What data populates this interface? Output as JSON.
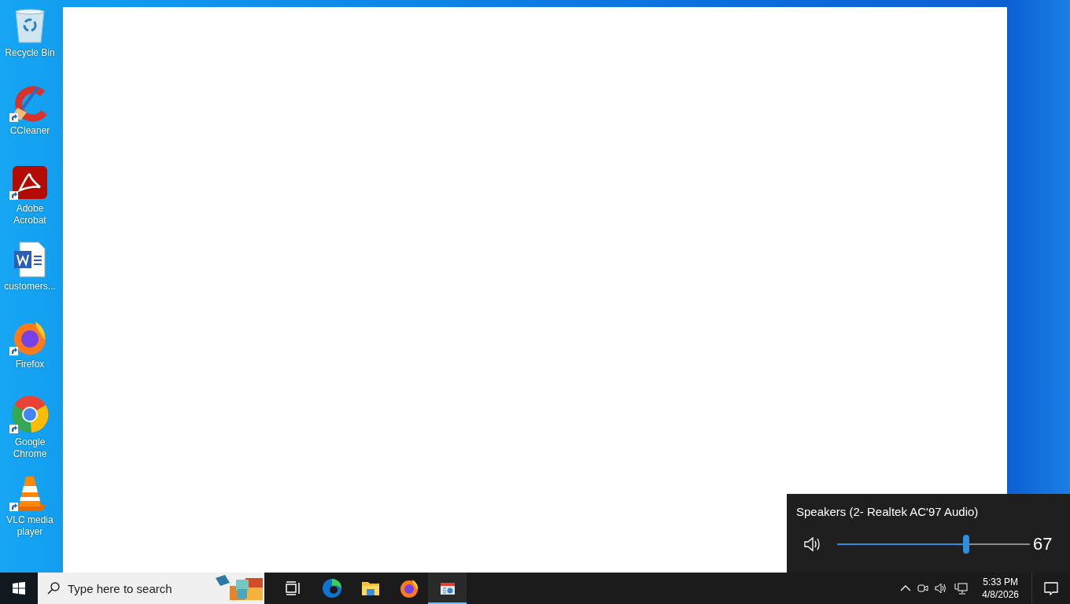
{
  "desktop_icons": [
    {
      "label": "Recycle Bin",
      "kind": "recycle",
      "shortcut": false
    },
    {
      "label": "CCleaner",
      "kind": "cleaner",
      "shortcut": true
    },
    {
      "label": "Adobe Acrobat",
      "kind": "acrobat",
      "shortcut": true
    },
    {
      "label": "customers...",
      "kind": "document",
      "shortcut": false
    },
    {
      "label": "Firefox",
      "kind": "firefox",
      "shortcut": true
    },
    {
      "label": "Google Chrome",
      "kind": "chrome",
      "shortcut": true
    },
    {
      "label": "VLC media player",
      "kind": "vlc",
      "shortcut": true
    }
  ],
  "taskbar": {
    "search": {
      "placeholder": "Type here to search"
    },
    "pinned": [
      {
        "kind": "taskview",
        "active": false
      },
      {
        "kind": "edge",
        "active": false
      },
      {
        "kind": "folder",
        "active": false
      },
      {
        "kind": "firefox",
        "active": false
      },
      {
        "kind": "calendar",
        "active": true
      }
    ],
    "clock": {
      "time": "5:33 PM",
      "date": "4/8/2026"
    }
  },
  "volume_flyout": {
    "device": "Speakers (2- Realtek AC'97 Audio)",
    "level": 0.67,
    "reading": "67"
  }
}
